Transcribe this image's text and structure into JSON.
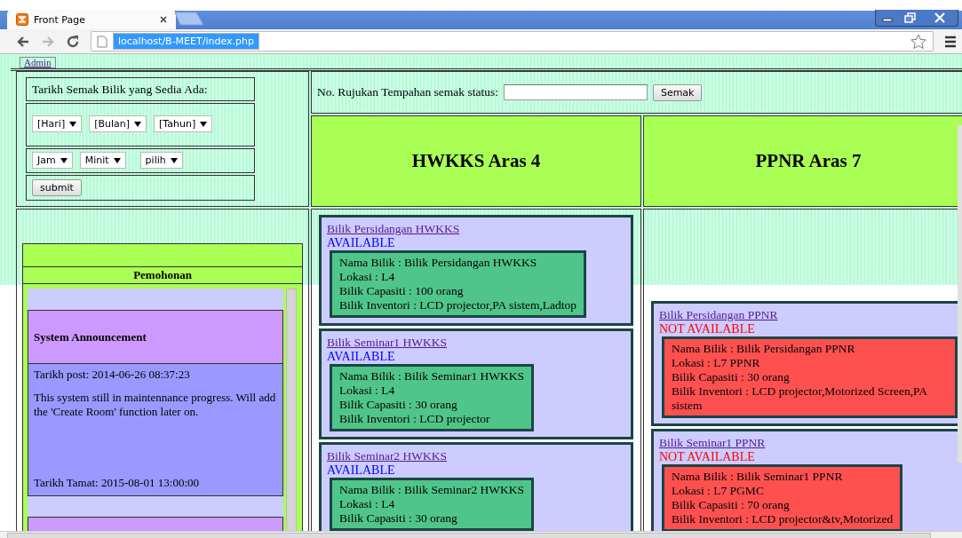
{
  "browser": {
    "tab_title": "Front Page",
    "url": "localhost/B-MEET/index.php",
    "url_selected": true,
    "forward_disabled": true
  },
  "admin_link": "Admin",
  "date_form": {
    "title": "Tarikh Semak Bilik yang Sedia Ada:",
    "date_selects": [
      "[Hari]",
      "[Bulan]",
      "[Tahun]"
    ],
    "time_selects": [
      "Jam",
      "Minit",
      "pilih"
    ],
    "submit": "submit"
  },
  "status_check": {
    "label": "No. Rujukan Tempahan semak status:",
    "button": "Semak"
  },
  "announcements": {
    "title": "Pemohonan",
    "items": [
      {
        "title": "System Announcement",
        "posted": "Tarikh post: 2014-06-26 08:37:23",
        "body": "This system still in maintennance progress. Will add the 'Create Room' function later on.",
        "ends": "Tarikh Tamat: 2015-08-01 13:00:00"
      }
    ]
  },
  "buildings": [
    {
      "name": "HWKKS Aras 4",
      "rooms": [
        {
          "name": "Bilik Persidangan HWKKS",
          "available": true,
          "status": "AVAILABLE",
          "details": [
            "Nama Bilik : Bilik Persidangan HWKKS",
            "Lokasi : L4",
            "Bilik Capasiti : 100 orang",
            "Bilik Inventori : LCD projector,PA sistem,Ladtop"
          ]
        },
        {
          "name": "Bilik Seminar1 HWKKS",
          "available": true,
          "status": "AVAILABLE",
          "details": [
            "Nama Bilik : Bilik Seminar1 HWKKS",
            "Lokasi : L4",
            "Bilik Capasiti : 30 orang",
            "Bilik Inventori : LCD projector"
          ]
        },
        {
          "name": "Bilik Seminar2 HWKKS",
          "available": true,
          "status": "AVAILABLE",
          "details": [
            "Nama Bilik : Bilik Seminar2 HWKKS",
            "Lokasi : L4",
            "Bilik Capasiti : 30 orang"
          ]
        }
      ]
    },
    {
      "name": "PPNR Aras 7",
      "rooms": [
        {
          "name": "Bilik Persidangan PPNR",
          "available": false,
          "status": "NOT AVAILABLE",
          "details": [
            "Nama Bilik : Bilik Persidangan PPNR",
            "Lokasi : L7 PPNR",
            "Bilik Capasiti : 30 orang",
            "Bilik Inventori : LCD projector,Motorized Screen,PA sistem"
          ]
        },
        {
          "name": "Bilik Seminar1 PPNR",
          "available": false,
          "status": "NOT AVAILABLE",
          "details": [
            "Nama Bilik : Bilik Seminar1 PPNR",
            "Lokasi : L7 PGMC",
            "Bilik Capasiti : 70 orang",
            "Bilik Inventori : LCD projector&tv,Motorized"
          ]
        }
      ]
    }
  ]
}
